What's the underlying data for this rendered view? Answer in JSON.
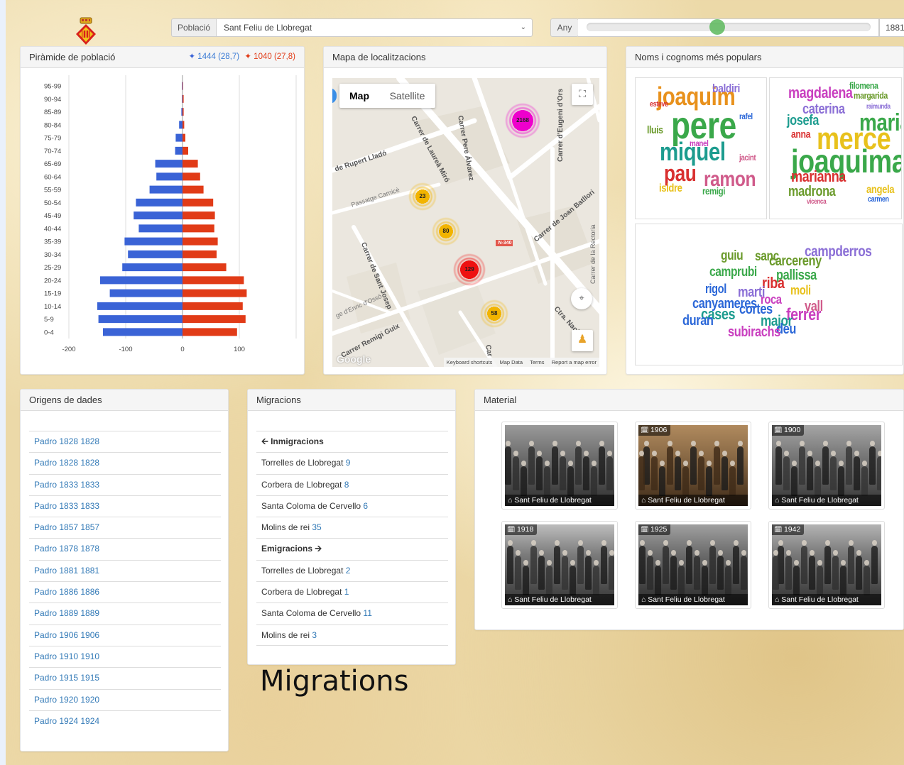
{
  "topbar": {
    "poblacio_label": "Població",
    "poblacio_value": "Sant Feliu de Llobregat",
    "any_label": "Any",
    "any_value": "1881",
    "slider_fraction": 0.46
  },
  "pyramid": {
    "title": "Piràmide de població",
    "male_summary": "1444 (28,7)",
    "female_summary": "1040 (27,8)",
    "colors": {
      "male": "#3a63d6",
      "female": "#e13b17"
    },
    "chart_data": {
      "type": "bar",
      "orientation": "horizontal",
      "categories": [
        "95-99",
        "90-94",
        "85-89",
        "80-84",
        "75-79",
        "70-74",
        "65-69",
        "60-64",
        "55-59",
        "50-54",
        "45-49",
        "40-44",
        "35-39",
        "30-34",
        "25-29",
        "20-24",
        "15-19",
        "10-14",
        "5-9",
        "0-4"
      ],
      "series": [
        {
          "values": [
            -1,
            -1,
            -2,
            -6,
            -12,
            -13,
            -48,
            -46,
            -58,
            -82,
            -86,
            -77,
            -102,
            -96,
            -106,
            -145,
            -128,
            -150,
            -148,
            -140
          ]
        },
        {
          "values": [
            1,
            2,
            2,
            3,
            5,
            10,
            27,
            31,
            37,
            54,
            57,
            56,
            62,
            60,
            77,
            108,
            113,
            106,
            111,
            96
          ]
        }
      ],
      "xlim": [
        -200,
        200
      ],
      "xticks": [
        "-200",
        "-100",
        "0",
        "100"
      ],
      "grid": true
    }
  },
  "map": {
    "title": "Mapa de localitzacions",
    "map_tab": "Map",
    "satellite_tab": "Satellite",
    "streets": [
      "Carrer Pere Álvarez",
      "Carrer de Laureà Miró",
      "de Rupert Lladó",
      "Passatge Carnicè",
      "Carrer d'Eugeni d'Ors",
      "Carrer de Joan Batllori",
      "Carrer de Sant Josep",
      "ge d'Enric d'Ossó",
      "Carrer Remigi Guix",
      "Ctra. Naci",
      "Carrer de la Rectoria",
      "N-340",
      "Car"
    ],
    "clusters": [
      "2168",
      "23",
      "80",
      "129",
      "58"
    ],
    "footer": [
      "Keyboard shortcuts",
      "Map Data",
      "Terms",
      "Report a map error"
    ],
    "google": "Google"
  },
  "names": {
    "title": "Noms i cognoms més populars",
    "male_words": [
      "joaquim",
      "baldiri",
      "esteve",
      "rafel",
      "pere",
      "lluis",
      "manel",
      "miquel",
      "jacint",
      "pau",
      "ramon",
      "isidre",
      "remigi"
    ],
    "female_words": [
      "filomena",
      "margarida",
      "magdalena",
      "raimunda",
      "caterina",
      "josefa",
      "maria",
      "anna",
      "merce",
      "joaquima",
      "marianna",
      "angela",
      "madrona",
      "carmen",
      "vicenca"
    ],
    "surnames": [
      "campderros",
      "guiu",
      "sanç",
      "carcereny",
      "camprubi",
      "pallissa",
      "riba",
      "moli",
      "rigol",
      "marti",
      "roca",
      "vall",
      "canyameres",
      "cortes",
      "ferrer",
      "cases",
      "duran",
      "major",
      "deu",
      "subirachs"
    ]
  },
  "origins": {
    "title": "Origens de dades",
    "items": [
      "Padro 1828 1828",
      "Padro 1828 1828",
      "Padro 1833 1833",
      "Padro 1833 1833",
      "Padro 1857 1857",
      "Padro 1878 1878",
      "Padro 1881 1881",
      "Padro 1886 1886",
      "Padro 1889 1889",
      "Padro 1906 1906",
      "Padro 1910 1910",
      "Padro 1915 1915",
      "Padro 1920 1920",
      "Padro 1924 1924"
    ]
  },
  "migrations": {
    "title": "Migracions",
    "immigrations_label": "Inmigracions",
    "immigrations": [
      {
        "place": "Torrelles de Llobregat",
        "count": "9"
      },
      {
        "place": "Corbera de Llobregat",
        "count": "8"
      },
      {
        "place": "Santa Coloma de Cervello",
        "count": "6"
      },
      {
        "place": "Molins de rei",
        "count": "35"
      }
    ],
    "emigrations_label": "Emigracions",
    "emigrations": [
      {
        "place": "Torrelles de Llobregat",
        "count": "2"
      },
      {
        "place": "Corbera de Llobregat",
        "count": "1"
      },
      {
        "place": "Santa Coloma de Cervello",
        "count": "11"
      },
      {
        "place": "Molins de rei",
        "count": "3"
      }
    ],
    "caption": "Migrations"
  },
  "material": {
    "title": "Material",
    "photos": [
      {
        "year": "",
        "caption": "Sant Feliu de Llobregat"
      },
      {
        "year": "1906",
        "caption": "Sant Feliu de Llobregat"
      },
      {
        "year": "1900",
        "caption": "Sant Feliu de Llobregat"
      },
      {
        "year": "1918",
        "caption": "Sant Feliu de Llobregat"
      },
      {
        "year": "1925",
        "caption": "Sant Feliu de Llobregat"
      },
      {
        "year": "1942",
        "caption": "Sant Feliu de Llobregat"
      }
    ]
  }
}
